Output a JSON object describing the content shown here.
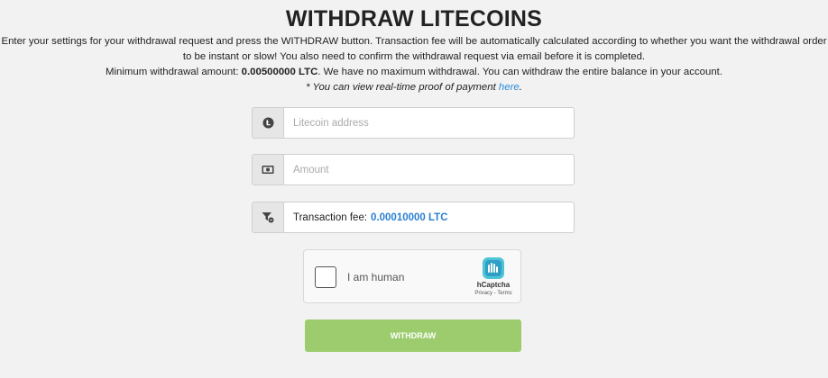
{
  "heading": "WITHDRAW LITECOINS",
  "description": {
    "line1": "Enter your settings for your withdrawal request and press the WITHDRAW button. Transaction fee will be automatically calculated according to whether you want the withdrawal order",
    "line2": "to be instant or slow! You also need to confirm the withdrawal request via email before it is completed.",
    "line3_prefix": "Minimum withdrawal amount: ",
    "min_amount": "0.00500000 LTC",
    "line3_suffix": ". We have no maximum withdrawal. You can withdraw the entire balance in your account.",
    "proof_prefix": "* You can view real-time proof of payment ",
    "proof_link": "here",
    "proof_suffix": "."
  },
  "form": {
    "address": {
      "placeholder": "Litecoin address",
      "value": "",
      "icon": "litecoin-icon"
    },
    "amount": {
      "placeholder": "Amount",
      "value": "",
      "icon": "cash-icon"
    },
    "fee": {
      "label": "Transaction fee:",
      "value": "0.00010000 LTC",
      "icon": "filter-fee-icon"
    }
  },
  "captcha": {
    "label": "I am human",
    "brand": "hCaptcha",
    "privacy": "Privacy",
    "separator": " - ",
    "terms": "Terms"
  },
  "submit_label": "WITHDRAW",
  "colors": {
    "link": "#2a8bd8",
    "fee_value": "#2a7fd0",
    "button": "#9ccc6d",
    "background": "#f2f2f2"
  }
}
